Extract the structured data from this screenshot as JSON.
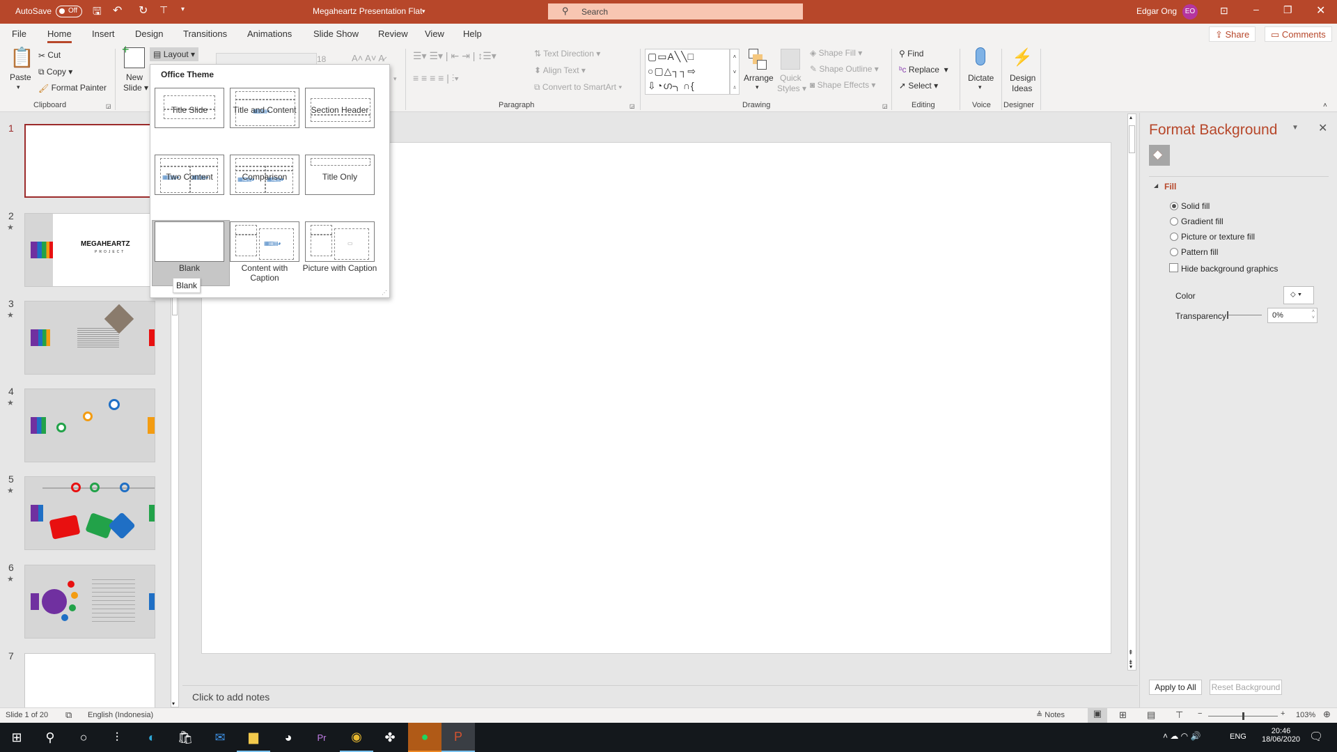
{
  "titlebar": {
    "autosave_label": "AutoSave",
    "autosave_state": "Off",
    "doc_title": "Megaheartz Presentation Flat",
    "search_placeholder": "Search",
    "user_name": "Edgar Ong",
    "user_initials": "EO",
    "accent_color": "#b7472a"
  },
  "tabs": [
    "File",
    "Home",
    "Insert",
    "Design",
    "Transitions",
    "Animations",
    "Slide Show",
    "Review",
    "View",
    "Help"
  ],
  "active_tab": "Home",
  "share_label": "Share",
  "comments_label": "Comments",
  "ribbon": {
    "clipboard": {
      "paste": "Paste",
      "cut": "Cut",
      "copy": "Copy",
      "format_painter": "Format Painter",
      "label": "Clipboard"
    },
    "slides": {
      "new_slide_1": "New",
      "new_slide_2": "Slide",
      "layout": "Layout"
    },
    "font": {
      "size": "18"
    },
    "paragraph": {
      "text_direction": "Text Direction",
      "align_text": "Align Text",
      "convert_smartart": "Convert to SmartArt",
      "label": "Paragraph"
    },
    "drawing": {
      "arrange": "Arrange",
      "quick_styles_1": "Quick",
      "quick_styles_2": "Styles",
      "shape_fill": "Shape Fill",
      "shape_outline": "Shape Outline",
      "shape_effects": "Shape Effects",
      "label": "Drawing"
    },
    "editing": {
      "find": "Find",
      "replace": "Replace",
      "select": "Select",
      "label": "Editing"
    },
    "voice": {
      "dictate": "Dictate",
      "label": "Voice"
    },
    "designer": {
      "design_ideas_1": "Design",
      "design_ideas_2": "Ideas",
      "label": "Designer"
    }
  },
  "layout_menu": {
    "heading": "Office Theme",
    "items": [
      "Title Slide",
      "Title and Content",
      "Section Header",
      "Two Content",
      "Comparison",
      "Title Only",
      "Blank",
      "Content with Caption",
      "Picture with Caption"
    ],
    "hovered": "Blank",
    "tooltip": "Blank"
  },
  "slides": [
    {
      "num": "1",
      "star": false
    },
    {
      "num": "2",
      "star": true,
      "logo": "MEGAHEARTZ",
      "logo_sub": "PROJECT"
    },
    {
      "num": "3",
      "star": true
    },
    {
      "num": "4",
      "star": true
    },
    {
      "num": "5",
      "star": true
    },
    {
      "num": "6",
      "star": true
    },
    {
      "num": "7",
      "star": false
    }
  ],
  "notes_placeholder": "Click to add notes",
  "format_background": {
    "title": "Format Background",
    "section": "Fill",
    "options": [
      "Solid fill",
      "Gradient fill",
      "Picture or texture fill",
      "Pattern fill"
    ],
    "selected": "Solid fill",
    "hide_bg_graphics": "Hide background graphics",
    "hide_bg_checked": false,
    "color_label": "Color",
    "transparency_label": "Transparency",
    "transparency_value": "0%",
    "apply_all": "Apply to All",
    "reset": "Reset Background"
  },
  "status": {
    "slide_info": "Slide 1 of 20",
    "language": "English (Indonesia)",
    "notes": "Notes",
    "zoom": "103%"
  },
  "taskbar": {
    "lang": "ENG",
    "time": "20:46",
    "date": "18/06/2020",
    "apps": [
      "start",
      "search",
      "cortana",
      "task-view",
      "edge",
      "store",
      "mail",
      "file-explorer",
      "steam",
      "premiere",
      "chrome",
      "davinci",
      "spotify",
      "powerpoint"
    ]
  }
}
